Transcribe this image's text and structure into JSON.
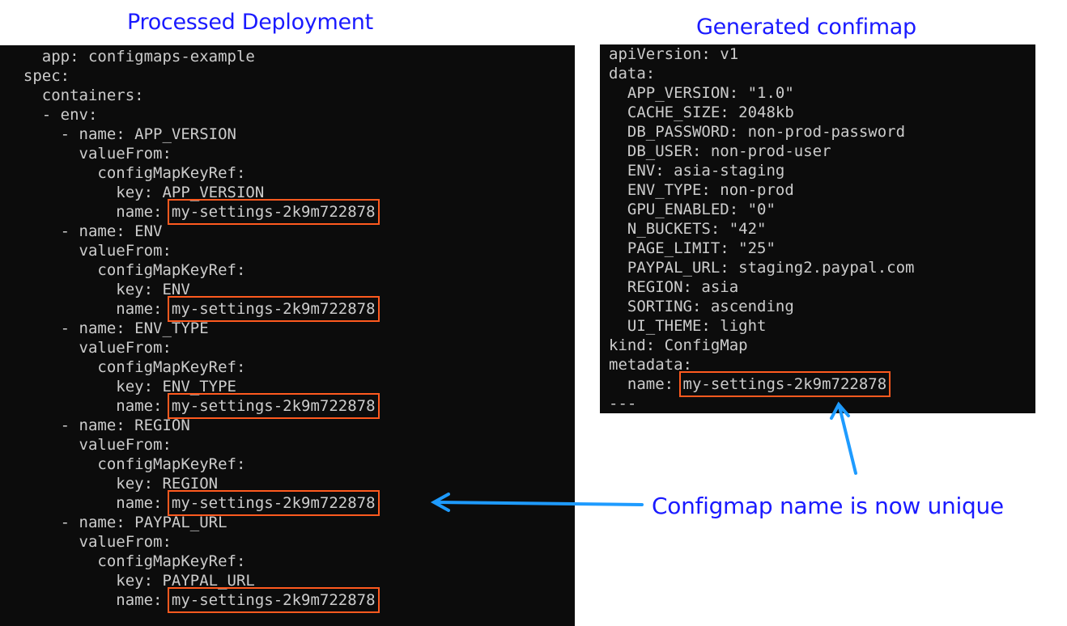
{
  "left_panel": {
    "heading": "Processed Deployment",
    "lines": [
      {
        "indent": "    ",
        "text": "app: configmaps-example"
      },
      {
        "indent": "  ",
        "text": "spec:"
      },
      {
        "indent": "    ",
        "text": "containers:"
      },
      {
        "indent": "    ",
        "text": "- env:"
      },
      {
        "indent": "      ",
        "text": "- name: APP_VERSION"
      },
      {
        "indent": "        ",
        "text": "valueFrom:"
      },
      {
        "indent": "          ",
        "text": "configMapKeyRef:"
      },
      {
        "indent": "            ",
        "text": "key: APP_VERSION"
      },
      {
        "indent": "            ",
        "text": "name: ",
        "highlight": "my-settings-2k9m722878"
      },
      {
        "indent": "      ",
        "text": "- name: ENV"
      },
      {
        "indent": "        ",
        "text": "valueFrom:"
      },
      {
        "indent": "          ",
        "text": "configMapKeyRef:"
      },
      {
        "indent": "            ",
        "text": "key: ENV"
      },
      {
        "indent": "            ",
        "text": "name: ",
        "highlight": "my-settings-2k9m722878"
      },
      {
        "indent": "      ",
        "text": "- name: ENV_TYPE"
      },
      {
        "indent": "        ",
        "text": "valueFrom:"
      },
      {
        "indent": "          ",
        "text": "configMapKeyRef:"
      },
      {
        "indent": "            ",
        "text": "key: ENV_TYPE"
      },
      {
        "indent": "            ",
        "text": "name: ",
        "highlight": "my-settings-2k9m722878"
      },
      {
        "indent": "      ",
        "text": "- name: REGION"
      },
      {
        "indent": "        ",
        "text": "valueFrom:"
      },
      {
        "indent": "          ",
        "text": "configMapKeyRef:"
      },
      {
        "indent": "            ",
        "text": "key: REGION"
      },
      {
        "indent": "            ",
        "text": "name: ",
        "highlight": "my-settings-2k9m722878"
      },
      {
        "indent": "      ",
        "text": "- name: PAYPAL_URL"
      },
      {
        "indent": "        ",
        "text": "valueFrom:"
      },
      {
        "indent": "          ",
        "text": "configMapKeyRef:"
      },
      {
        "indent": "            ",
        "text": "key: PAYPAL_URL"
      },
      {
        "indent": "            ",
        "text": "name: ",
        "highlight": "my-settings-2k9m722878"
      }
    ]
  },
  "right_panel": {
    "heading": "Generated confimap",
    "lines": [
      {
        "indent": "",
        "text": "apiVersion: v1"
      },
      {
        "indent": "",
        "text": "data:"
      },
      {
        "indent": "  ",
        "text": "APP_VERSION: \"1.0\""
      },
      {
        "indent": "  ",
        "text": "CACHE_SIZE: 2048kb"
      },
      {
        "indent": "  ",
        "text": "DB_PASSWORD: non-prod-password"
      },
      {
        "indent": "  ",
        "text": "DB_USER: non-prod-user"
      },
      {
        "indent": "  ",
        "text": "ENV: asia-staging"
      },
      {
        "indent": "  ",
        "text": "ENV_TYPE: non-prod"
      },
      {
        "indent": "  ",
        "text": "GPU_ENABLED: \"0\""
      },
      {
        "indent": "  ",
        "text": "N_BUCKETS: \"42\""
      },
      {
        "indent": "  ",
        "text": "PAGE_LIMIT: \"25\""
      },
      {
        "indent": "  ",
        "text": "PAYPAL_URL: staging2.paypal.com"
      },
      {
        "indent": "  ",
        "text": "REGION: asia"
      },
      {
        "indent": "  ",
        "text": "SORTING: ascending"
      },
      {
        "indent": "  ",
        "text": "UI_THEME: light"
      },
      {
        "indent": "",
        "text": "kind: ConfigMap"
      },
      {
        "indent": "",
        "text": "metadata:"
      },
      {
        "indent": "  ",
        "text": "name: ",
        "highlight": "my-settings-2k9m722878"
      },
      {
        "indent": "",
        "text": "---"
      }
    ]
  },
  "caption": "Configmap name is now unique",
  "colors": {
    "heading": "#1a1aff",
    "terminal_bg": "#0c0c0c",
    "terminal_text": "#cccccc",
    "highlight_box": "#ff5a1f",
    "arrow": "#1e9bff"
  }
}
